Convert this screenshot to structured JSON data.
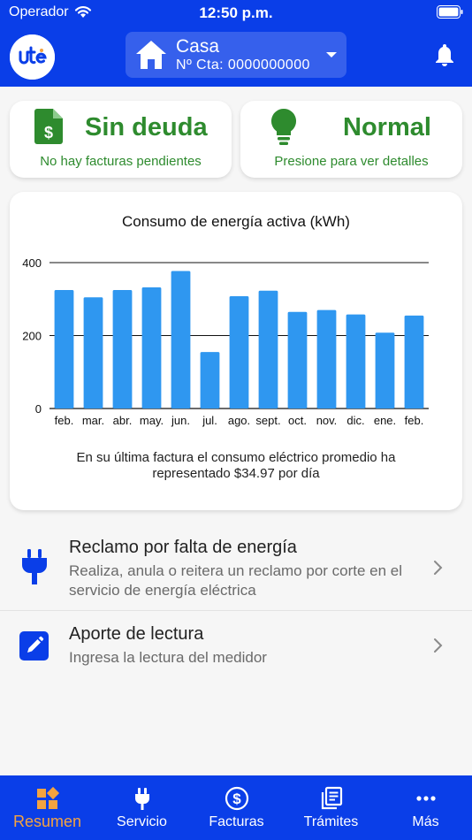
{
  "status_bar": {
    "carrier": "Operador",
    "time": "12:50 p.m."
  },
  "header": {
    "account_name": "Casa",
    "account_number": "Nº Cta: 0000000000"
  },
  "debt_card": {
    "title": "Sin deuda",
    "subtitle": "No hay facturas pendientes"
  },
  "supply_card": {
    "title": "Normal",
    "subtitle": "Presione para ver detalles"
  },
  "chart_data": {
    "type": "bar",
    "title": "Consumo de energía activa (kWh)",
    "categories": [
      "feb.",
      "mar.",
      "abr.",
      "may.",
      "jun.",
      "jul.",
      "ago.",
      "sept.",
      "oct.",
      "nov.",
      "dic.",
      "ene.",
      "feb."
    ],
    "values": [
      325,
      305,
      325,
      332,
      377,
      155,
      308,
      323,
      265,
      270,
      258,
      208,
      255
    ],
    "ylim": [
      0,
      400
    ],
    "yticks": [
      "0",
      "200",
      "400"
    ],
    "bar_color": "#2f97f0",
    "grid": true,
    "xlabel": "",
    "ylabel": ""
  },
  "chart_note": "En su última factura el consumo eléctrico promedio ha representado $34.97 por día",
  "list": {
    "claim": {
      "title": "Reclamo por falta de energía",
      "description": "Realiza, anula o reitera un reclamo por corte en el servicio de energía eléctrica"
    },
    "reading": {
      "title": "Aporte de lectura",
      "description": "Ingresa la lectura del medidor"
    }
  },
  "tabs": [
    {
      "label": "Resumen",
      "icon": "summary-icon",
      "active": true
    },
    {
      "label": "Servicio",
      "icon": "plug-icon",
      "active": false
    },
    {
      "label": "Facturas",
      "icon": "dollar-icon",
      "active": false
    },
    {
      "label": "Trámites",
      "icon": "documents-icon",
      "active": false
    },
    {
      "label": "Más",
      "icon": "more-icon",
      "active": false
    }
  ],
  "colors": {
    "brand_blue": "#0a3ee8",
    "success_green": "#2e8b2e",
    "active_tab": "#f4a340"
  }
}
